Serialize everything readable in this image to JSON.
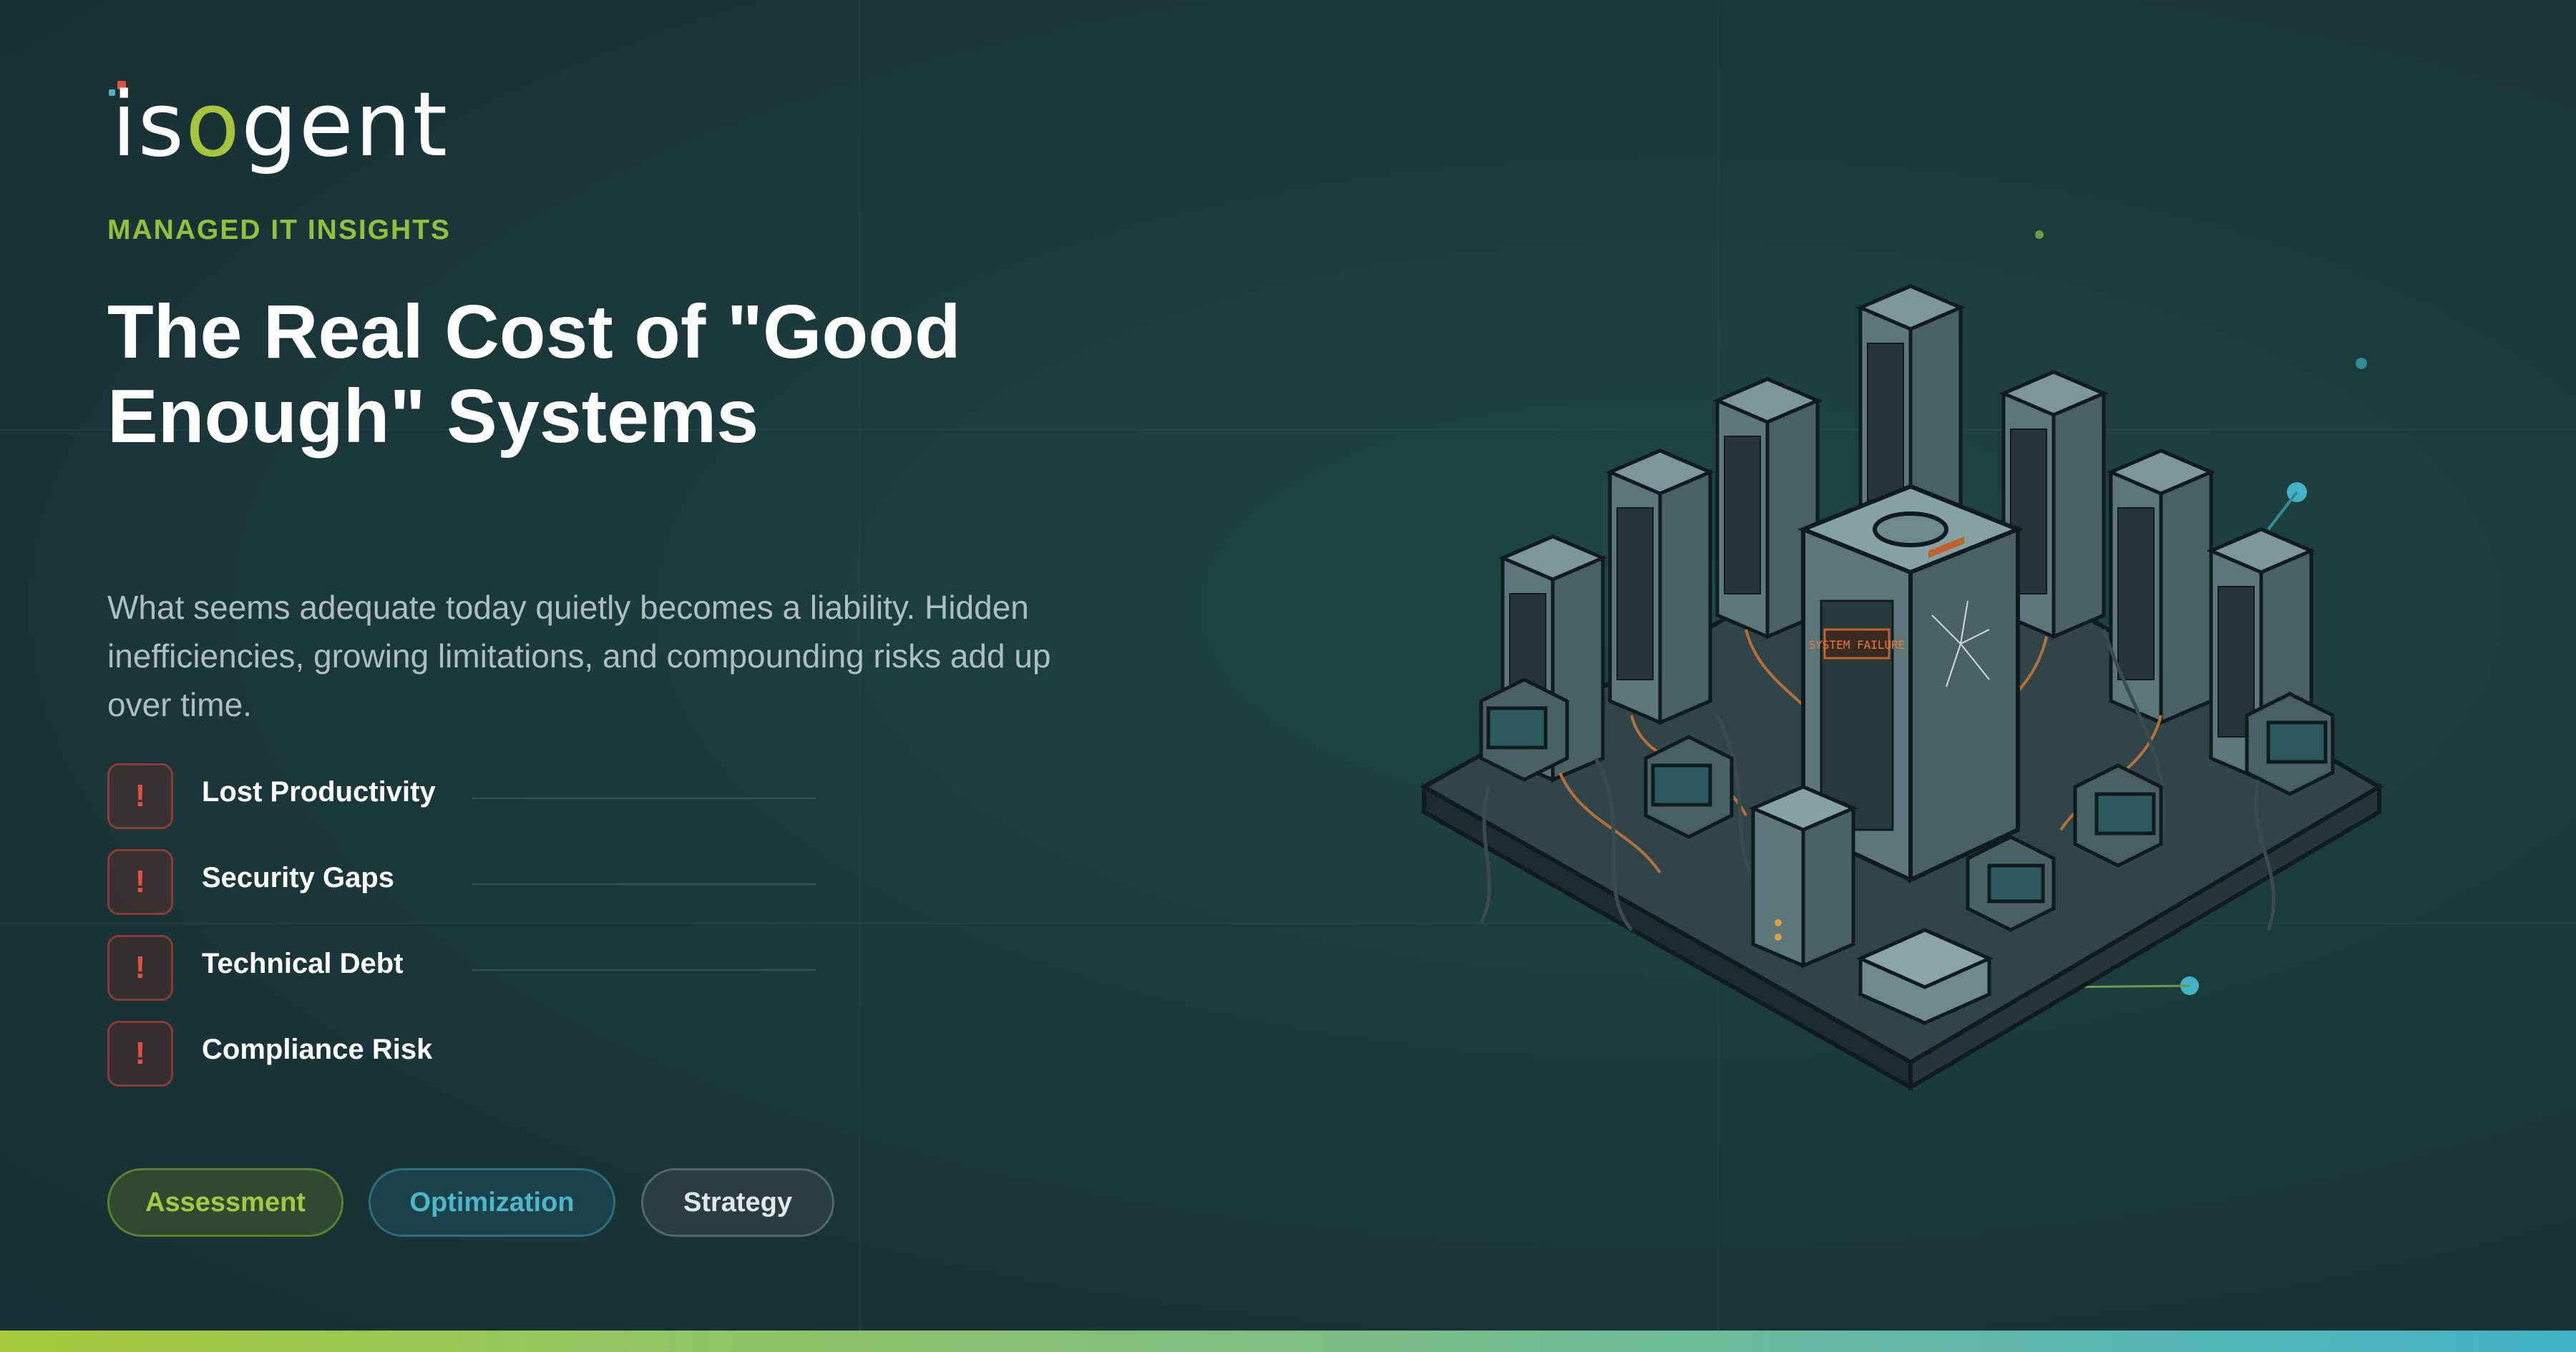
{
  "brand": {
    "name_parts": [
      "is",
      "o",
      "gent"
    ],
    "accent": "#a6c43c",
    "dot_colors": [
      "#e5513d",
      "#4bb8c9",
      "#a6c43c"
    ]
  },
  "eyebrow": "MANAGED IT INSIGHTS",
  "title": "The Real Cost of \"Good Enough\" Systems",
  "description": "What seems adequate today quietly becomes a liability. Hidden inefficiencies, growing limitations, and compounding risks add up over time.",
  "risks": [
    {
      "icon": "exclamation-icon",
      "badge": "!",
      "label": "Lost Productivity"
    },
    {
      "icon": "exclamation-icon",
      "badge": "!",
      "label": "Security Gaps"
    },
    {
      "icon": "exclamation-icon",
      "badge": "!",
      "label": "Technical Debt"
    },
    {
      "icon": "exclamation-icon",
      "badge": "!",
      "label": "Compliance Risk"
    }
  ],
  "tags": [
    {
      "label": "Assessment",
      "color": "#9fcb43"
    },
    {
      "label": "Optimization",
      "color": "#4bb8c9"
    },
    {
      "label": "Strategy",
      "color": "#e4e8e8"
    }
  ],
  "illustration": {
    "name": "isometric-server-room",
    "sign_text": "SYSTEM FAILURE"
  },
  "bottom_bar_gradient": [
    "#a5c93b",
    "#7fbf84",
    "#43b3c9"
  ]
}
